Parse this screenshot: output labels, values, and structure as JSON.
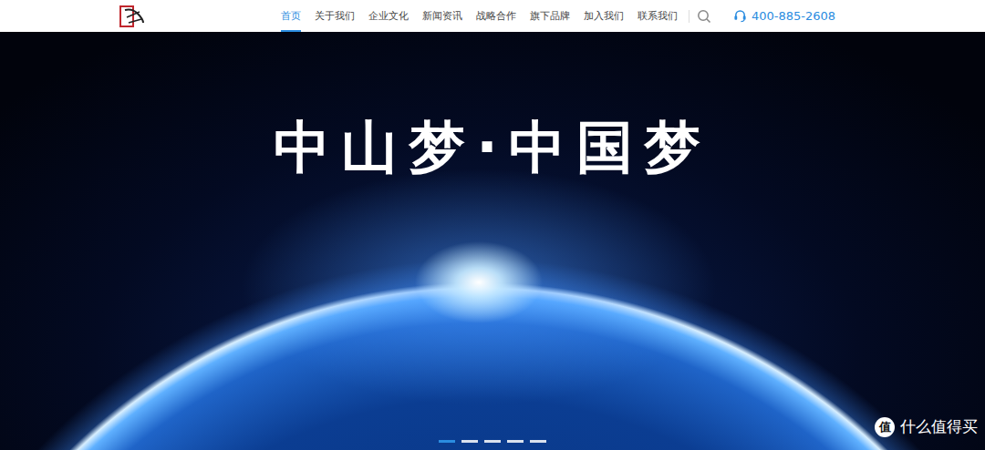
{
  "nav": {
    "items": [
      {
        "label": "首页",
        "selected": true
      },
      {
        "label": "关于我们",
        "selected": false
      },
      {
        "label": "企业文化",
        "selected": false
      },
      {
        "label": "新闻资讯",
        "selected": false
      },
      {
        "label": "战略合作",
        "selected": false
      },
      {
        "label": "旗下品牌",
        "selected": false
      },
      {
        "label": "加入我们",
        "selected": false
      },
      {
        "label": "联系我们",
        "selected": false
      }
    ]
  },
  "phone": "400-885-2608",
  "hero": {
    "title": "中山梦·中国梦",
    "slides": [
      {
        "selected": true
      },
      {
        "selected": false
      },
      {
        "selected": false
      },
      {
        "selected": false
      },
      {
        "selected": false
      }
    ]
  },
  "watermark": {
    "icon": "值",
    "text": "什么值得买"
  }
}
